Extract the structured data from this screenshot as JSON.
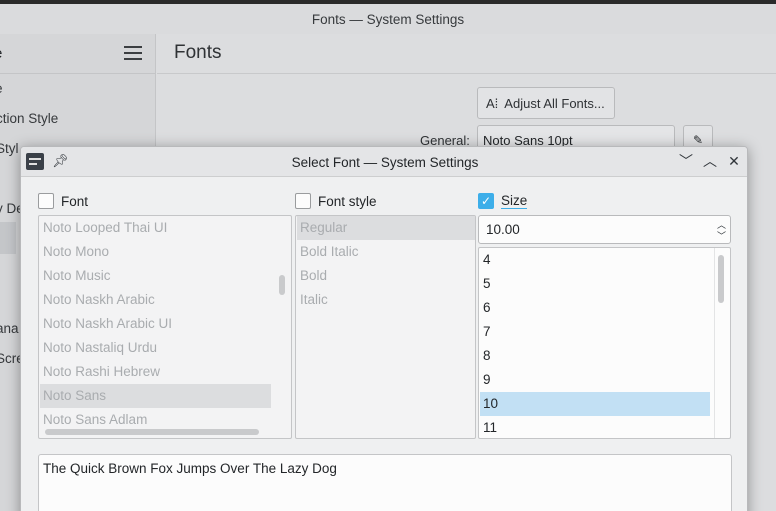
{
  "background_window": {
    "title": "Fonts — System Settings",
    "sidebar_header": "e",
    "sidebar_items": [
      "e",
      "ction Style",
      "Styl",
      "y De",
      "ana",
      "Scre"
    ],
    "page_title": "Fonts",
    "adjust_all_label": "Adjust All Fonts...",
    "general_label": "General:",
    "general_value": "Noto Sans 10pt"
  },
  "dialog": {
    "title": "Select Font — System Settings",
    "font_header": "Font",
    "font_style_header": "Font style",
    "size_header": "Size",
    "size_checked": true,
    "fonts": [
      "Noto Looped Thai UI",
      "Noto Mono",
      "Noto Music",
      "Noto Naskh Arabic",
      "Noto Naskh Arabic UI",
      "Noto Nastaliq Urdu",
      "Noto Rashi Hebrew",
      "Noto Sans",
      "Noto Sans Adlam"
    ],
    "selected_font": "Noto Sans",
    "styles": [
      "Regular",
      "Bold Italic",
      "Bold",
      "Italic"
    ],
    "selected_style": "Regular",
    "size_value": "10.00",
    "sizes": [
      "4",
      "5",
      "6",
      "7",
      "8",
      "9",
      "10",
      "11"
    ],
    "selected_size": "10",
    "preview_text": "The Quick Brown Fox Jumps Over The Lazy Dog"
  },
  "icons": {
    "app": "settings-app-icon",
    "pin": "pin-icon",
    "minimize": "chevron-down-icon",
    "maximize": "chevron-up-icon",
    "close": "close-icon",
    "hamburger": "hamburger-menu-icon",
    "adjust": "font-adjust-icon",
    "edit": "pencil-icon"
  },
  "colors": {
    "accent": "#3daee9",
    "selection": "#c2e0f4"
  }
}
